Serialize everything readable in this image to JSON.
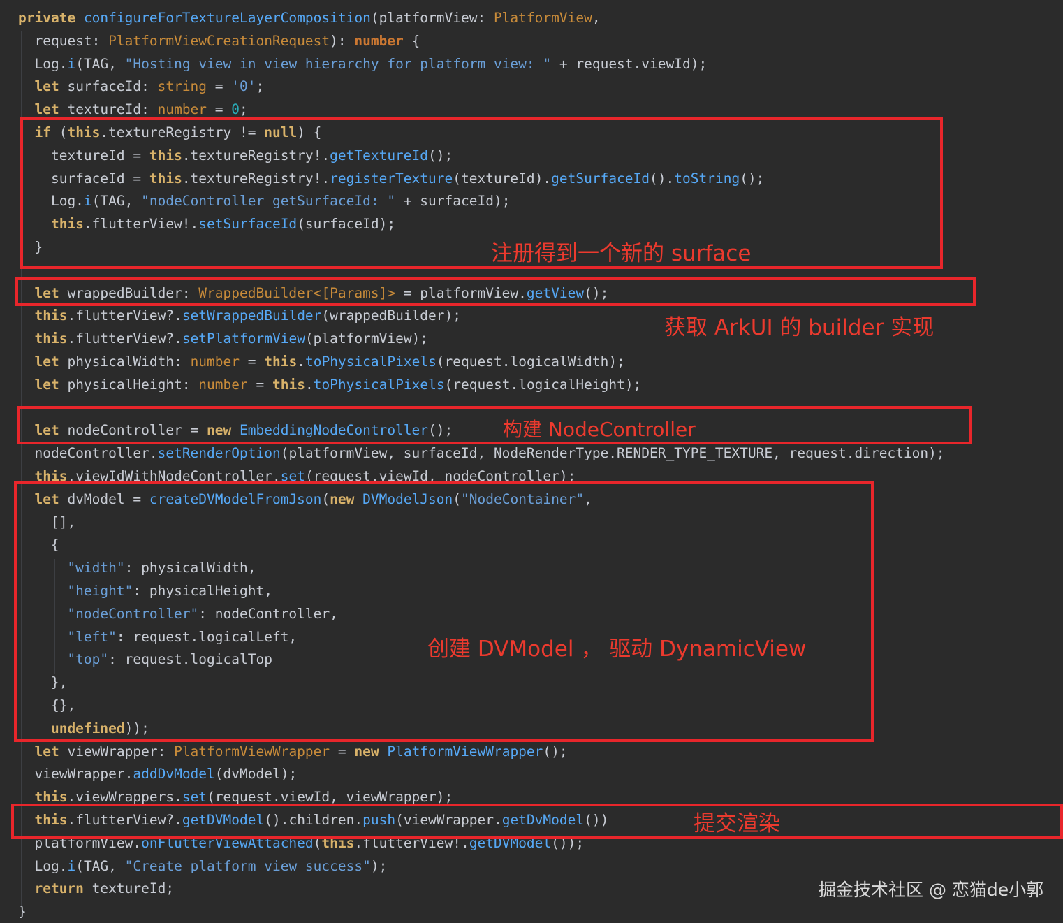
{
  "editor": {
    "lines": [
      [
        [
          "kw2",
          "private "
        ],
        [
          "fn",
          "configureForTextureLayerComposition"
        ],
        [
          "pr",
          "(platformView: "
        ],
        [
          "ty",
          "PlatformView"
        ],
        [
          "pr",
          ","
        ]
      ],
      [
        [
          "pr",
          "  request: "
        ],
        [
          "ty",
          "PlatformViewCreationRequest"
        ],
        [
          "pr",
          "): "
        ],
        [
          "kw",
          "number"
        ],
        [
          "pr",
          " {"
        ]
      ],
      [
        [
          "pr",
          "  Log."
        ],
        [
          "fn",
          "i"
        ],
        [
          "pr",
          "(TAG, "
        ],
        [
          "str",
          "\"Hosting view in view hierarchy for platform view: \""
        ],
        [
          "pr",
          " + request.viewId);"
        ]
      ],
      [
        [
          "kw2",
          "  let "
        ],
        [
          "pr",
          "surfaceId: "
        ],
        [
          "ty",
          "string"
        ],
        [
          "pr",
          " = "
        ],
        [
          "str",
          "'0'"
        ],
        [
          "pr",
          ";"
        ]
      ],
      [
        [
          "kw2",
          "  let "
        ],
        [
          "pr",
          "textureId: "
        ],
        [
          "ty",
          "number"
        ],
        [
          "pr",
          " = "
        ],
        [
          "num",
          "0"
        ],
        [
          "pr",
          ";"
        ]
      ],
      [
        [
          "kw2",
          "  if "
        ],
        [
          "pr",
          "("
        ],
        [
          "kw2",
          "this"
        ],
        [
          "pr",
          ".textureRegistry != "
        ],
        [
          "kw2",
          "null"
        ],
        [
          "pr",
          ") {"
        ]
      ],
      [
        [
          "pr",
          "    textureId = "
        ],
        [
          "kw2",
          "this"
        ],
        [
          "pr",
          ".textureRegistry!."
        ],
        [
          "fn",
          "getTextureId"
        ],
        [
          "pr",
          "();"
        ]
      ],
      [
        [
          "pr",
          "    surfaceId = "
        ],
        [
          "kw2",
          "this"
        ],
        [
          "pr",
          ".textureRegistry!."
        ],
        [
          "fn",
          "registerTexture"
        ],
        [
          "pr",
          "(textureId)."
        ],
        [
          "fn",
          "getSurfaceId"
        ],
        [
          "pr",
          "()."
        ],
        [
          "fn",
          "toString"
        ],
        [
          "pr",
          "();"
        ]
      ],
      [
        [
          "pr",
          "    Log."
        ],
        [
          "fn",
          "i"
        ],
        [
          "pr",
          "(TAG, "
        ],
        [
          "str",
          "\"nodeController getSurfaceId: \""
        ],
        [
          "pr",
          " + surfaceId);"
        ]
      ],
      [
        [
          "kw2",
          "    this"
        ],
        [
          "pr",
          ".flutterView!."
        ],
        [
          "fn",
          "setSurfaceId"
        ],
        [
          "pr",
          "(surfaceId);"
        ]
      ],
      [
        [
          "pr",
          "  }"
        ]
      ],
      [
        [
          "pr",
          ""
        ]
      ],
      [
        [
          "kw2",
          "  let "
        ],
        [
          "pr",
          "wrappedBuilder: "
        ],
        [
          "ty",
          "WrappedBuilder<[Params]>"
        ],
        [
          "pr",
          " = platformView."
        ],
        [
          "fn",
          "getView"
        ],
        [
          "pr",
          "();"
        ]
      ],
      [
        [
          "kw2",
          "  this"
        ],
        [
          "pr",
          ".flutterView?."
        ],
        [
          "fn",
          "setWrappedBuilder"
        ],
        [
          "pr",
          "(wrappedBuilder);"
        ]
      ],
      [
        [
          "kw2",
          "  this"
        ],
        [
          "pr",
          ".flutterView?."
        ],
        [
          "fn",
          "setPlatformView"
        ],
        [
          "pr",
          "(platformView);"
        ]
      ],
      [
        [
          "kw2",
          "  let "
        ],
        [
          "pr",
          "physicalWidth: "
        ],
        [
          "ty",
          "number"
        ],
        [
          "pr",
          " = "
        ],
        [
          "kw2",
          "this"
        ],
        [
          "pr",
          "."
        ],
        [
          "fn",
          "toPhysicalPixels"
        ],
        [
          "pr",
          "(request.logicalWidth);"
        ]
      ],
      [
        [
          "kw2",
          "  let "
        ],
        [
          "pr",
          "physicalHeight: "
        ],
        [
          "ty",
          "number"
        ],
        [
          "pr",
          " = "
        ],
        [
          "kw2",
          "this"
        ],
        [
          "pr",
          "."
        ],
        [
          "fn",
          "toPhysicalPixels"
        ],
        [
          "pr",
          "(request.logicalHeight);"
        ]
      ],
      [
        [
          "pr",
          ""
        ]
      ],
      [
        [
          "kw2",
          "  let "
        ],
        [
          "pr",
          "nodeController = "
        ],
        [
          "kw2",
          "new "
        ],
        [
          "fn",
          "EmbeddingNodeController"
        ],
        [
          "pr",
          "();"
        ]
      ],
      [
        [
          "pr",
          "  nodeController."
        ],
        [
          "fn",
          "setRenderOption"
        ],
        [
          "pr",
          "(platformView, surfaceId, NodeRenderType.RENDER_TYPE_TEXTURE, request.direction);"
        ]
      ],
      [
        [
          "kw2",
          "  this"
        ],
        [
          "pr",
          ".viewIdWithNodeController."
        ],
        [
          "fn",
          "set"
        ],
        [
          "pr",
          "(request.viewId, nodeController);"
        ]
      ],
      [
        [
          "kw2",
          "  let "
        ],
        [
          "pr",
          "dvModel = "
        ],
        [
          "fn",
          "createDVModelFromJson"
        ],
        [
          "pr",
          "("
        ],
        [
          "kw2",
          "new "
        ],
        [
          "fn",
          "DVModelJson"
        ],
        [
          "pr",
          "("
        ],
        [
          "str",
          "\"NodeContainer\""
        ],
        [
          "pr",
          ","
        ]
      ],
      [
        [
          "pr",
          "    [],"
        ]
      ],
      [
        [
          "pr",
          "    {"
        ]
      ],
      [
        [
          "str",
          "      \"width\""
        ],
        [
          "pr",
          ": physicalWidth,"
        ]
      ],
      [
        [
          "str",
          "      \"height\""
        ],
        [
          "pr",
          ": physicalHeight,"
        ]
      ],
      [
        [
          "str",
          "      \"nodeController\""
        ],
        [
          "pr",
          ": nodeController,"
        ]
      ],
      [
        [
          "str",
          "      \"left\""
        ],
        [
          "pr",
          ": request.logicalLeft,"
        ]
      ],
      [
        [
          "str",
          "      \"top\""
        ],
        [
          "pr",
          ": request.logicalTop"
        ]
      ],
      [
        [
          "pr",
          "    },"
        ]
      ],
      [
        [
          "pr",
          "    {},"
        ]
      ],
      [
        [
          "kw2",
          "    undefined"
        ],
        [
          "pr",
          "));"
        ]
      ],
      [
        [
          "kw2",
          "  let "
        ],
        [
          "pr",
          "viewWrapper: "
        ],
        [
          "ty",
          "PlatformViewWrapper"
        ],
        [
          "pr",
          " = "
        ],
        [
          "kw2",
          "new "
        ],
        [
          "fn",
          "PlatformViewWrapper"
        ],
        [
          "pr",
          "();"
        ]
      ],
      [
        [
          "pr",
          "  viewWrapper."
        ],
        [
          "fn",
          "addDvModel"
        ],
        [
          "pr",
          "(dvModel);"
        ]
      ],
      [
        [
          "kw2",
          "  this"
        ],
        [
          "pr",
          ".viewWrappers."
        ],
        [
          "fn",
          "set"
        ],
        [
          "pr",
          "(request.viewId, viewWrapper);"
        ]
      ],
      [
        [
          "kw2",
          "  this"
        ],
        [
          "pr",
          ".flutterView?."
        ],
        [
          "fn",
          "getDVModel"
        ],
        [
          "pr",
          "().children."
        ],
        [
          "fn",
          "push"
        ],
        [
          "pr",
          "(viewWrapper."
        ],
        [
          "fn",
          "getDvModel"
        ],
        [
          "pr",
          "())"
        ]
      ],
      [
        [
          "pr",
          "  platformView."
        ],
        [
          "fn",
          "onFlutterViewAttached"
        ],
        [
          "pr",
          "("
        ],
        [
          "kw2",
          "this"
        ],
        [
          "pr",
          ".flutterView!."
        ],
        [
          "fn",
          "getDVModel"
        ],
        [
          "pr",
          "());"
        ]
      ],
      [
        [
          "pr",
          "  Log."
        ],
        [
          "fn",
          "i"
        ],
        [
          "pr",
          "(TAG, "
        ],
        [
          "str",
          "\"Create platform view success\""
        ],
        [
          "pr",
          ");"
        ]
      ],
      [
        [
          "kw2",
          "  return "
        ],
        [
          "pr",
          "textureId;"
        ]
      ],
      [
        [
          "pr",
          "}"
        ]
      ]
    ]
  },
  "annotations": {
    "note_surface": "注册得到一个新的 surface",
    "note_builder": "获取 ArkUI 的 builder 实现",
    "note_node": "构建 NodeController",
    "note_dvmodel": "创建 DVModel ， 驱动 DynamicView",
    "note_render": "提交渲染"
  },
  "watermark": "掘金技术社区 @ 恋猫de小郭",
  "colors": {
    "background": "#2b2b2b",
    "keyword": "#d8b26a",
    "type": "#c88b3a",
    "function": "#56a8f5",
    "string": "#6a9fd8",
    "number": "#2aacb8",
    "annotation": "#e8262b"
  }
}
